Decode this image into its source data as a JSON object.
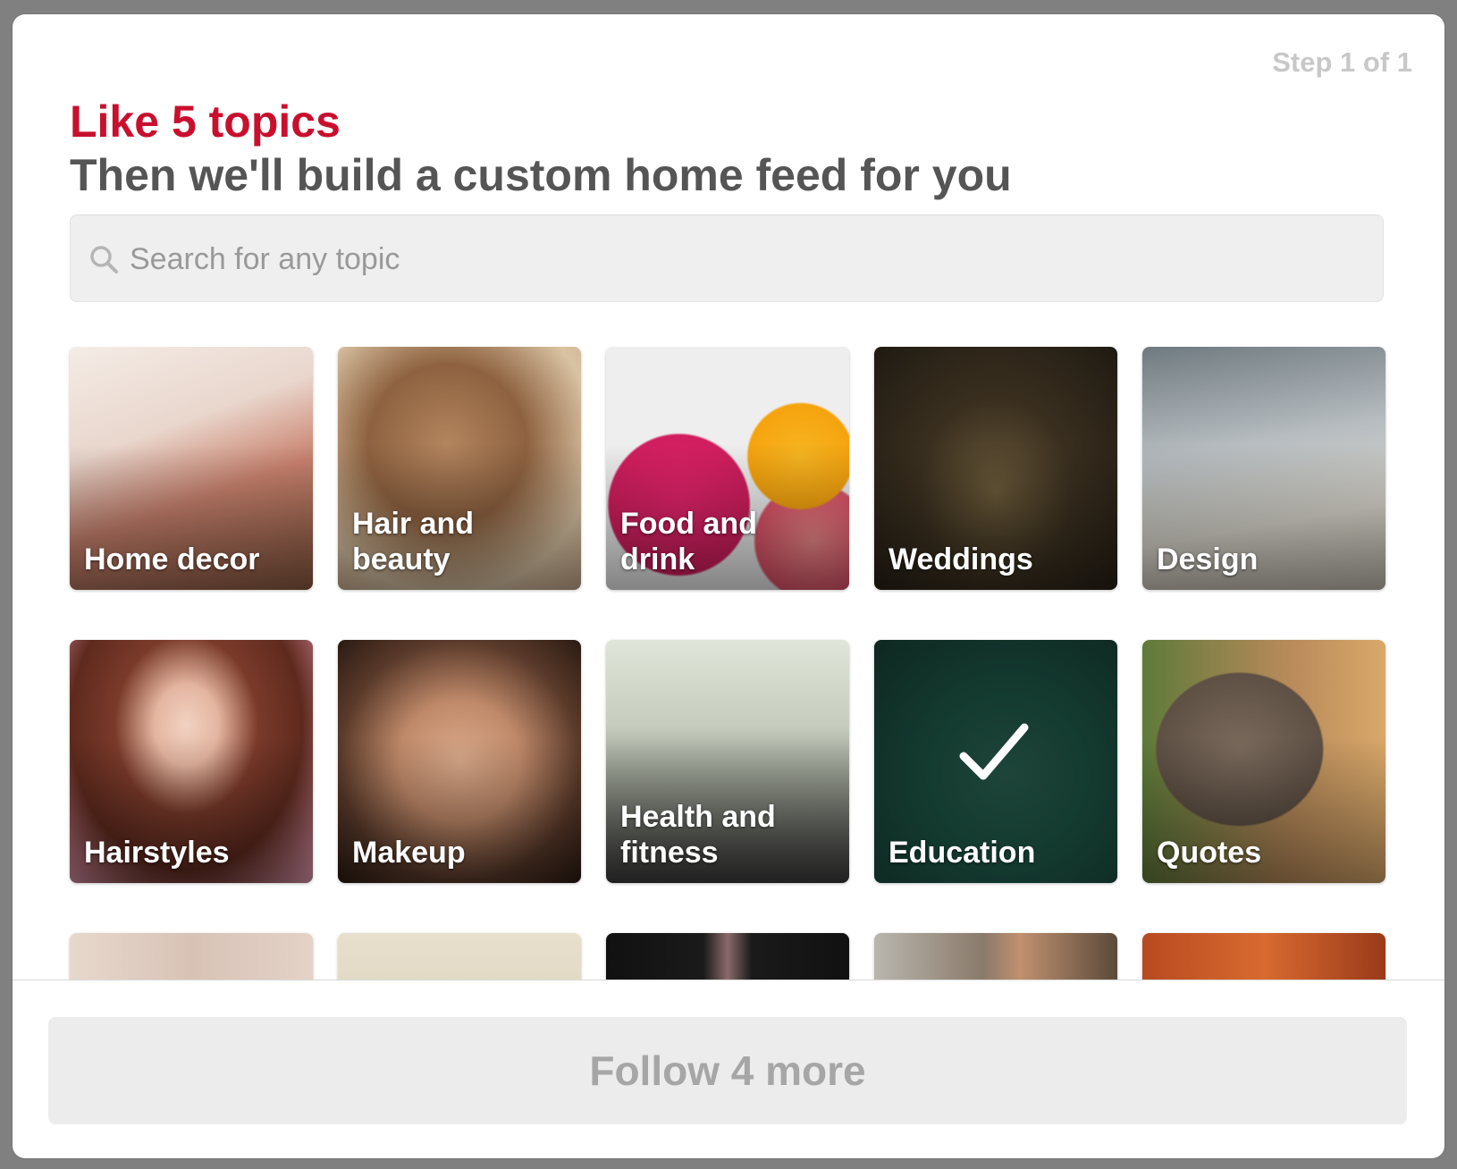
{
  "header": {
    "step": "Step 1 of 1",
    "title": "Like 5 topics",
    "subtitle": "Then we'll build a custom home feed for you"
  },
  "search": {
    "placeholder": "Search for any topic",
    "value": "",
    "icon": "search-icon"
  },
  "topics": [
    {
      "label": "Home decor",
      "selected": false
    },
    {
      "label": "Hair and\nbeauty",
      "selected": false
    },
    {
      "label": "Food and\ndrink",
      "selected": false
    },
    {
      "label": "Weddings",
      "selected": false
    },
    {
      "label": "Design",
      "selected": false
    },
    {
      "label": "Hairstyles",
      "selected": false
    },
    {
      "label": "Makeup",
      "selected": false
    },
    {
      "label": "Health and\nfitness",
      "selected": false
    },
    {
      "label": "Education",
      "selected": true
    },
    {
      "label": "Quotes",
      "selected": false
    }
  ],
  "footer": {
    "follow_label": "Follow 4 more"
  }
}
